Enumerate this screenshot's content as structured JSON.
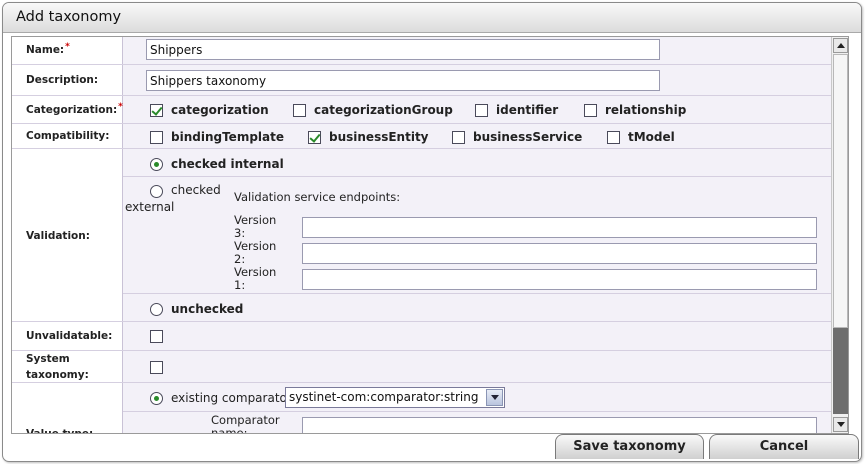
{
  "dialog": {
    "title": "Add taxonomy"
  },
  "fields": {
    "name": {
      "label": "Name:",
      "value": "Shippers"
    },
    "description": {
      "label": "Description:",
      "value": "Shippers taxonomy"
    },
    "required_marker": "*",
    "categorization": {
      "label": "Categorization:",
      "options": [
        {
          "label": "categorization",
          "checked": true
        },
        {
          "label": "categorizationGroup",
          "checked": false
        },
        {
          "label": "identifier",
          "checked": false
        },
        {
          "label": "relationship",
          "checked": false
        }
      ]
    },
    "compatibility": {
      "label": "Compatibility:",
      "options": [
        {
          "label": "bindingTemplate",
          "checked": false
        },
        {
          "label": "businessEntity",
          "checked": true
        },
        {
          "label": "businessService",
          "checked": false
        },
        {
          "label": "tModel",
          "checked": false
        }
      ]
    },
    "validation": {
      "label": "Validation:",
      "checked_internal": "checked internal",
      "checked_external_1": "checked",
      "checked_external_2": "external",
      "endpoints_label": "Validation service endpoints:",
      "versions": [
        {
          "line1": "Version",
          "line2": "3:",
          "value": ""
        },
        {
          "line1": "Version",
          "line2": "2:",
          "value": ""
        },
        {
          "line1": "Version",
          "line2": "1:",
          "value": ""
        }
      ],
      "unchecked": "unchecked",
      "selected": "checked internal"
    },
    "unvalidatable": {
      "label": "Unvalidatable:",
      "checked": false
    },
    "system_taxonomy": {
      "label_line1": "System",
      "label_line2": "taxonomy:",
      "checked": false
    },
    "value_type": {
      "label": "Value type:",
      "existing_comparator": "existing comparator",
      "comparator_selected": "systinet-com:comparator:string",
      "comparator_name_line1": "Comparator",
      "comparator_name_line2": "name:",
      "comparator_name_value": ""
    }
  },
  "buttons": {
    "save": "Save taxonomy",
    "cancel": "Cancel"
  },
  "colors": {
    "accent_check": "#2a8a2a",
    "row_bg": "#f3f1f8",
    "required": "#cc0000"
  }
}
